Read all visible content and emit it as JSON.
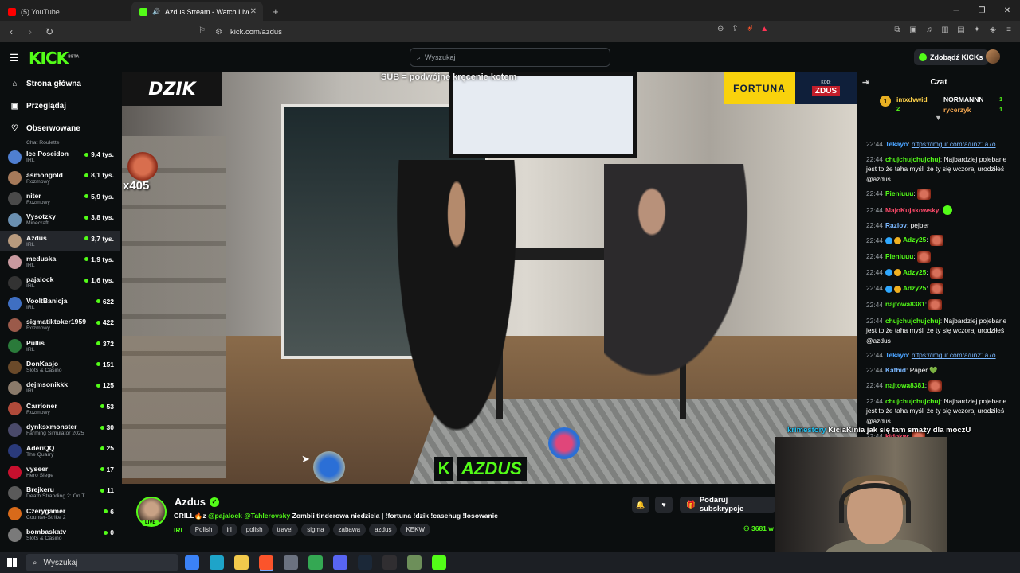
{
  "browser": {
    "tabs": [
      {
        "label": "(5) YouTube",
        "favicon_color": "#ff0000",
        "active": false
      },
      {
        "label": "Azdus Stream - Watch Live o",
        "favicon_color": "#53fc18",
        "active": true
      }
    ],
    "url": "kick.com/azdus"
  },
  "kick": {
    "logo": "KICK",
    "logo_badge": "BETA",
    "search_placeholder": "Wyszukaj",
    "get_kicks": "Zdobądź KICKs"
  },
  "sidebar": {
    "nav": [
      {
        "label": "Strona główna",
        "icon": "home-icon"
      },
      {
        "label": "Przeglądaj",
        "icon": "browse-icon"
      },
      {
        "label": "Obserwowane",
        "icon": "heart-icon"
      }
    ],
    "partial_category": "Chat Roulette",
    "channels": [
      {
        "name": "Ice Poseidon",
        "category": "IRL",
        "viewers": "9,4 tys.",
        "color": "#4f7fd1"
      },
      {
        "name": "asmongold",
        "category": "Rozmowy",
        "viewers": "8,1 tys.",
        "color": "#a67a5a"
      },
      {
        "name": "niter",
        "category": "Rozmowy",
        "viewers": "5,9 tys.",
        "color": "#4a4a4a"
      },
      {
        "name": "Vysotzky",
        "category": "Minecraft",
        "viewers": "3,8 tys.",
        "color": "#6a8fb0"
      },
      {
        "name": "Azdus",
        "category": "IRL",
        "viewers": "3,7 tys.",
        "color": "#b89a7d"
      },
      {
        "name": "meduska",
        "category": "IRL",
        "viewers": "1,9 tys.",
        "color": "#c99aa0"
      },
      {
        "name": "pajalock",
        "category": "IRL",
        "viewers": "1,6 tys.",
        "color": "#333333"
      },
      {
        "name": "VooltBanicja",
        "category": "IRL",
        "viewers": "622",
        "color": "#3f6fc2"
      },
      {
        "name": "sigmatiktoker1959",
        "category": "Rozmowy",
        "viewers": "422",
        "color": "#9b5a4a"
      },
      {
        "name": "Pullis",
        "category": "IRL",
        "viewers": "372",
        "color": "#2a7a3a"
      },
      {
        "name": "DonKasjo",
        "category": "Slots & Casino",
        "viewers": "151",
        "color": "#6a4a2a"
      },
      {
        "name": "dejmsonikkk",
        "category": "IRL",
        "viewers": "125",
        "color": "#8a7a6a"
      },
      {
        "name": "Carrioner",
        "category": "Rozmowy",
        "viewers": "53",
        "color": "#b04a3a"
      },
      {
        "name": "dynksxmonster",
        "category": "Farming Simulator 2025",
        "viewers": "30",
        "color": "#4a4a6a"
      },
      {
        "name": "AderiQQ",
        "category": "The Quarry",
        "viewers": "25",
        "color": "#2a3a7a"
      },
      {
        "name": "vyseer",
        "category": "Hero Siege",
        "viewers": "17",
        "color": "#c8102e"
      },
      {
        "name": "Brejkeru",
        "category": "Death Stranding 2: On T…",
        "viewers": "11",
        "color": "#5a5a5a"
      },
      {
        "name": "Czerygamer",
        "category": "Counter-Strike 2",
        "viewers": "6",
        "color": "#d86a1a"
      },
      {
        "name": "bombaskatv",
        "category": "Slots & Casino",
        "viewers": "0",
        "color": "#7a7a7a"
      }
    ]
  },
  "video": {
    "sponsor_left": "DZIK",
    "banner_text": "SUB = podwójne kręcenie kotem",
    "sponsor_right": "FORTUNA",
    "code_label": "KOD:",
    "code_value": "ZDUS",
    "multiplier": "x405",
    "streamer_logo_k": "K",
    "streamer_logo": "AZDUS"
  },
  "overlay_chat": {
    "user": "krimestory",
    "text": "KiciaKinia jak się tam smaży dla moczU"
  },
  "stream": {
    "name": "Azdus",
    "live": "LIVE",
    "title_prefix": "GRILL🔥z ",
    "mentions": "@pajalock @Tahlerovsky",
    "title_rest": " Zombii tinderowa niedziela | !fortuna !dzik !casehug !losowanie",
    "category": "IRL",
    "tags": [
      "Polish",
      "irl",
      "polish",
      "travel",
      "sigma",
      "zabawa",
      "azdus",
      "KEKW"
    ],
    "gift_button": "Podaruj subskrypcje",
    "viewers": "3681 w"
  },
  "chat": {
    "title": "Czat",
    "leaderboard": {
      "first_user": "imxdvwid",
      "first_count": "2",
      "second_user": "NORMANNN",
      "second_count": "1",
      "third_user": "rycerzyk",
      "third_count": "1"
    },
    "messages": [
      {
        "time": "22:44",
        "user": "Tekayo",
        "color": "#4aa3ff",
        "text": "",
        "link": "https://imgur.com/a/un21a7o"
      },
      {
        "time": "22:44",
        "user": "chujchujchujchuj",
        "color": "#53fc18",
        "text": "Najbardziej pojebane jest to że taha myśli że ty się wczoraj urodziłeś @azdus"
      },
      {
        "time": "22:44",
        "user": "Pieniuuu",
        "color": "#53fc18",
        "text": "",
        "emote": true
      },
      {
        "time": "22:44",
        "user": "MajoKujakowsky",
        "color": "#ff4a6a",
        "text": "",
        "emote_green": true
      },
      {
        "time": "22:44",
        "user": "Razlov",
        "color": "#7ab7ff",
        "text": "pejper"
      },
      {
        "time": "22:44",
        "user": "Adzy25",
        "color": "#53fc18",
        "text": "",
        "emote": true,
        "badges": true
      },
      {
        "time": "22:44",
        "user": "Pieniuuu",
        "color": "#53fc18",
        "text": "",
        "emote": true
      },
      {
        "time": "22:44",
        "user": "Adzy25",
        "color": "#53fc18",
        "text": "",
        "emote": true,
        "badges": true
      },
      {
        "time": "22:44",
        "user": "Adzy25",
        "color": "#53fc18",
        "text": "",
        "emote": true,
        "badges": true
      },
      {
        "time": "22:44",
        "user": "najtowa8381",
        "color": "#53fc18",
        "text": "",
        "emote": true
      },
      {
        "time": "22:44",
        "user": "chujchujchujchuj",
        "color": "#53fc18",
        "text": "Najbardziej pojebane jest to że taha myśli że ty się wczoraj urodziłeś @azdus"
      },
      {
        "time": "22:44",
        "user": "Tekayo",
        "color": "#4aa3ff",
        "text": "",
        "link": "https://imgur.com/a/un21a7o"
      },
      {
        "time": "22:44",
        "user": "Kathid",
        "color": "#7ab7ff",
        "text": "Paper 💚"
      },
      {
        "time": "22:44",
        "user": "najtowa8381",
        "color": "#53fc18",
        "text": "",
        "emote": true
      },
      {
        "time": "22:44",
        "user": "chujchujchujchuj",
        "color": "#53fc18",
        "text": "Najbardziej pojebane jest to że taha myśli że ty się wczoraj urodziłeś @azdus"
      },
      {
        "time": "22:44",
        "user": "kidokw",
        "color": "#ff4a6a",
        "text": "",
        "emote": true
      }
    ]
  },
  "taskbar": {
    "search_placeholder": "Wyszukaj",
    "apps": [
      {
        "name": "task-view-icon",
        "color": "#3b82f6"
      },
      {
        "name": "edge-icon",
        "color": "#1ea4c9"
      },
      {
        "name": "file-explorer-icon",
        "color": "#f2c94c"
      },
      {
        "name": "brave-icon",
        "color": "#fb542b"
      },
      {
        "name": "store-icon",
        "color": "#6b7280"
      },
      {
        "name": "chrome-icon",
        "color": "#34a853"
      },
      {
        "name": "discord-icon",
        "color": "#5865f2"
      },
      {
        "name": "steam-icon",
        "color": "#1b2838"
      },
      {
        "name": "obs-icon",
        "color": "#302e31"
      },
      {
        "name": "app-icon",
        "color": "#6d8f5a"
      },
      {
        "name": "kick-app-icon",
        "color": "#53fc18"
      }
    ]
  }
}
